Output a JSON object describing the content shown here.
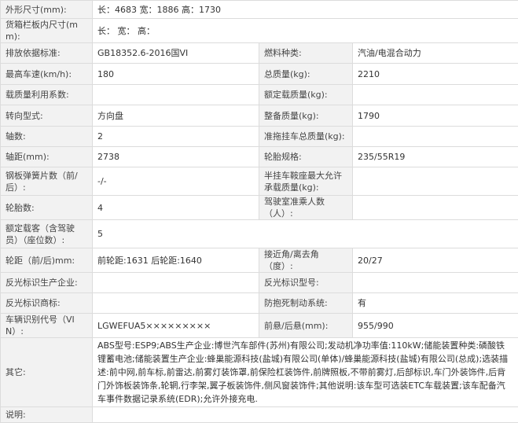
{
  "rows": [
    {
      "type": "wide",
      "label": "外形尺寸(mm):",
      "value": "长：4683 宽：1886 高：1730"
    },
    {
      "type": "wide",
      "label": "货箱栏板内尺寸(mm):",
      "value": "长：  宽：  高："
    },
    {
      "type": "pair",
      "label1": "排放依据标准:",
      "value1": "GB18352.6-2016国VI",
      "label2": "燃料种类:",
      "value2": "汽油/电混合动力"
    },
    {
      "type": "pair",
      "label1": "最高车速(km/h):",
      "value1": "180",
      "label2": "总质量(kg):",
      "value2": "2210"
    },
    {
      "type": "pair",
      "label1": "载质量利用系数:",
      "value1": "",
      "label2": "额定载质量(kg):",
      "value2": ""
    },
    {
      "type": "pair",
      "label1": "转向型式:",
      "value1": "方向盘",
      "label2": "整备质量(kg):",
      "value2": "1790"
    },
    {
      "type": "pair",
      "label1": "轴数:",
      "value1": "2",
      "label2": "准拖挂车总质量(kg):",
      "value2": ""
    },
    {
      "type": "pair",
      "label1": "轴距(mm):",
      "value1": "2738",
      "label2": "轮胎规格:",
      "value2": "235/55R19"
    },
    {
      "type": "pair",
      "label1": "钢板弹簧片数（前/后）:",
      "value1": "-/-",
      "label2": "半挂车鞍座最大允许承载质量(kg):",
      "value2": ""
    },
    {
      "type": "pair",
      "label1": "轮胎数:",
      "value1": "4",
      "label2": "驾驶室准乘人数（人）:",
      "value2": ""
    },
    {
      "type": "wide",
      "label": "额定载客（含驾驶员）（座位数）:",
      "value": "5"
    },
    {
      "type": "pair",
      "label1": "轮距（前/后)mm:",
      "value1": "前轮距:1631 后轮距:1640",
      "label2": "接近角/离去角（度）:",
      "value2": "20/27"
    },
    {
      "type": "pair",
      "label1": "反光标识生产企业:",
      "value1": "",
      "label2": "反光标识型号:",
      "value2": ""
    },
    {
      "type": "pair",
      "label1": "反光标识商标:",
      "value1": "",
      "label2": "防抱死制动系统:",
      "value2": "有"
    },
    {
      "type": "pair",
      "label1": "车辆识别代号（VIN）:",
      "value1": "LGWEFUA5×××××××××",
      "label2": "前悬/后悬(mm):",
      "value2": "955/990"
    },
    {
      "type": "wide",
      "label": "其它:",
      "value": "ABS型号:ESP9;ABS生产企业:博世汽车部件(苏州)有限公司;发动机净功率值:110kW;储能装置种类:磷酸铁锂蓄电池;储能装置生产企业:蜂巢能源科技(盐城)有限公司(单体)/蜂巢能源科技(盐城)有限公司(总成);选装描述:前中网,前车标,前雷达,前雾灯装饰罩,前保险杠装饰件,前牌照板,不带前雾灯,后部标识,车门外装饰件,后背门外饰板装饰条,轮辋,行李架,翼子板装饰件,侧风窗装饰件;其他说明:该车型可选装ETC车载装置;该车配备汽车事件数据记录系统(EDR);允许外接充电."
    },
    {
      "type": "wide",
      "label": "说明:",
      "value": ""
    }
  ]
}
